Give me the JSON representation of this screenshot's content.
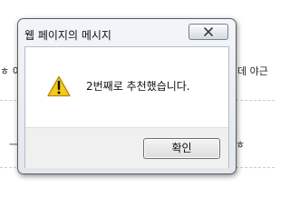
{
  "background": {
    "left_text": "ㅎ 이",
    "right_text": "데 야근",
    "bottom_left_text": "ㅡ",
    "bottom_right_text": "ㅎ"
  },
  "dialog": {
    "title": "웹 페이지의 메시지",
    "close_icon": "close-x-icon",
    "warning_icon": "warning-triangle-icon",
    "message": "2번째로 추천했습니다.",
    "ok_label": "확인",
    "colors": {
      "frame": "#5d5d5d",
      "warning": "#f3c91c",
      "button": "#dddddd"
    }
  }
}
